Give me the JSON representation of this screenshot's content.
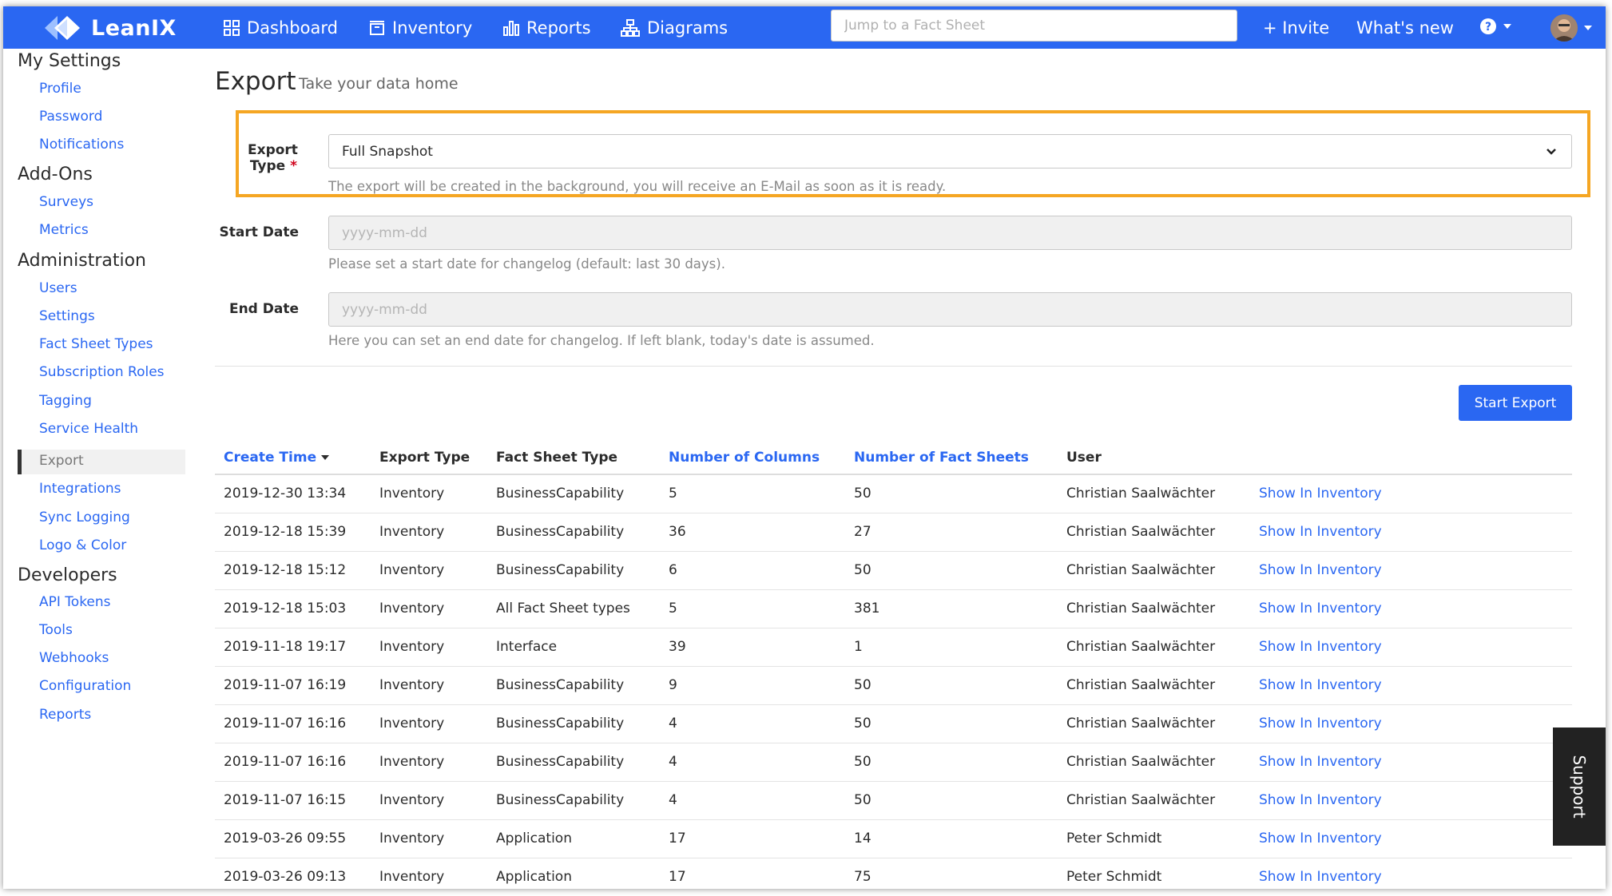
{
  "nav": {
    "brand": "LeanIX",
    "items": [
      {
        "label": "Dashboard",
        "icon": "dashboard-grid-icon"
      },
      {
        "label": "Inventory",
        "icon": "inventory-box-icon"
      },
      {
        "label": "Reports",
        "icon": "reports-bar-icon"
      },
      {
        "label": "Diagrams",
        "icon": "diagrams-hierarchy-icon"
      }
    ],
    "search_placeholder": "Jump to a Fact Sheet",
    "invite": "+ Invite",
    "whats_new": "What's new"
  },
  "sidebar": {
    "sections": [
      {
        "heading": "My Settings",
        "items": [
          "Profile",
          "Password",
          "Notifications"
        ]
      },
      {
        "heading": "Add-Ons",
        "items": [
          "Surveys",
          "Metrics"
        ]
      },
      {
        "heading": "Administration",
        "items": [
          "Users",
          "Settings",
          "Fact Sheet Types",
          "Subscription Roles",
          "Tagging",
          "Service Health",
          "Export",
          "Integrations",
          "Sync Logging",
          "Logo & Color"
        ]
      },
      {
        "heading": "Developers",
        "items": [
          "API Tokens",
          "Tools",
          "Webhooks",
          "Configuration",
          "Reports"
        ]
      }
    ],
    "active": "Export"
  },
  "page": {
    "title": "Export",
    "subtitle": "Take your data home"
  },
  "form": {
    "export_type_label_1": "Export",
    "export_type_label_2": "Type",
    "required_mark": "*",
    "export_type_value": "Full Snapshot",
    "export_type_hint": "The export will be created in the background, you will receive an E-Mail as soon as it is ready.",
    "start_date_label": "Start Date",
    "start_date_placeholder": "yyyy-mm-dd",
    "start_date_hint": "Please set a start date for changelog (default: last 30 days).",
    "end_date_label": "End Date",
    "end_date_placeholder": "yyyy-mm-dd",
    "end_date_hint": "Here you can set an end date for changelog. If left blank, today's date is assumed.",
    "start_button": "Start Export"
  },
  "table": {
    "headers": [
      "Create Time",
      "Export Type",
      "Fact Sheet Type",
      "Number of Columns",
      "Number of Fact Sheets",
      "User"
    ],
    "rows": [
      [
        "2019-12-30 13:34",
        "Inventory",
        "BusinessCapability",
        "5",
        "50",
        "Christian Saalwächter",
        "Show In Inventory"
      ],
      [
        "2019-12-18 15:39",
        "Inventory",
        "BusinessCapability",
        "36",
        "27",
        "Christian Saalwächter",
        "Show In Inventory"
      ],
      [
        "2019-12-18 15:12",
        "Inventory",
        "BusinessCapability",
        "6",
        "50",
        "Christian Saalwächter",
        "Show In Inventory"
      ],
      [
        "2019-12-18 15:03",
        "Inventory",
        "All Fact Sheet types",
        "5",
        "381",
        "Christian Saalwächter",
        "Show In Inventory"
      ],
      [
        "2019-11-18 19:17",
        "Inventory",
        "Interface",
        "39",
        "1",
        "Christian Saalwächter",
        "Show In Inventory"
      ],
      [
        "2019-11-07 16:19",
        "Inventory",
        "BusinessCapability",
        "9",
        "50",
        "Christian Saalwächter",
        "Show In Inventory"
      ],
      [
        "2019-11-07 16:16",
        "Inventory",
        "BusinessCapability",
        "4",
        "50",
        "Christian Saalwächter",
        "Show In Inventory"
      ],
      [
        "2019-11-07 16:16",
        "Inventory",
        "BusinessCapability",
        "4",
        "50",
        "Christian Saalwächter",
        "Show In Inventory"
      ],
      [
        "2019-11-07 16:15",
        "Inventory",
        "BusinessCapability",
        "4",
        "50",
        "Christian Saalwächter",
        "Show In Inventory"
      ],
      [
        "2019-03-26 09:55",
        "Inventory",
        "Application",
        "17",
        "14",
        "Peter Schmidt",
        "Show In Inventory"
      ],
      [
        "2019-03-26 09:13",
        "Inventory",
        "Application",
        "17",
        "75",
        "Peter Schmidt",
        "Show In Inventory"
      ]
    ]
  },
  "support": "Support",
  "colors": {
    "brand": "#2a67f2",
    "highlight": "#f5a623",
    "required": "#d0021b"
  }
}
